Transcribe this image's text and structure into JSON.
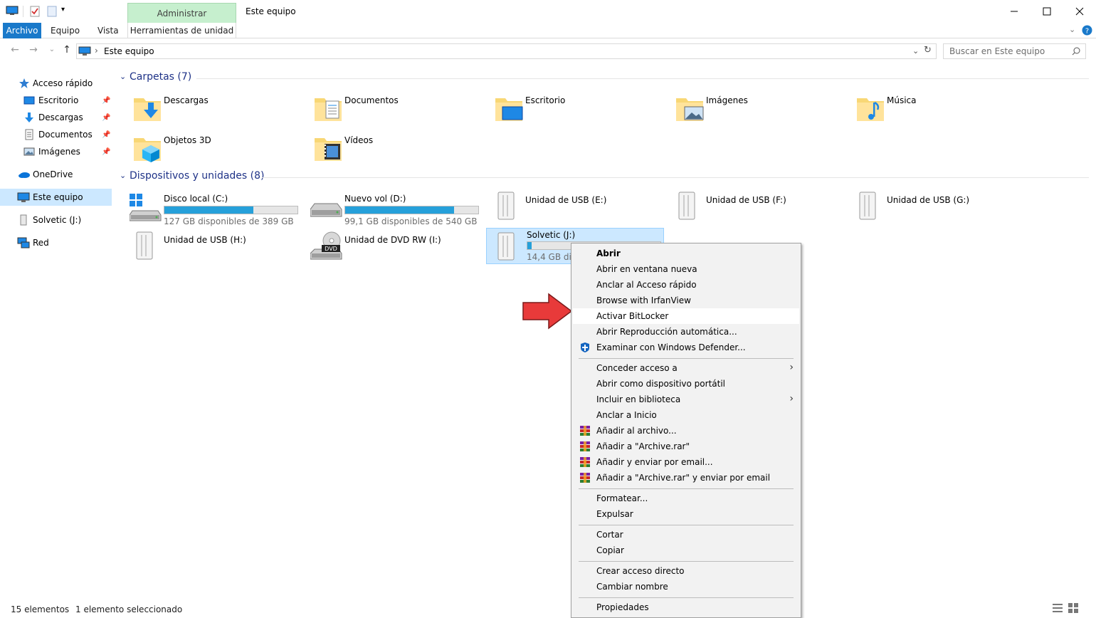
{
  "window": {
    "title": "Este equipo"
  },
  "ribbon": {
    "context_tab": "Administrar",
    "context_subtitle": "Herramientas de unidad",
    "tabs": [
      "Archivo",
      "Equipo",
      "Vista"
    ]
  },
  "address": {
    "path": "Este equipo",
    "search_placeholder": "Buscar en Este equipo"
  },
  "sidebar": {
    "items": [
      {
        "label": "Acceso rápido",
        "icon": "star-icon"
      },
      {
        "label": "Escritorio",
        "icon": "desktop-icon",
        "pinned": true
      },
      {
        "label": "Descargas",
        "icon": "download-icon",
        "pinned": true
      },
      {
        "label": "Documentos",
        "icon": "document-icon",
        "pinned": true
      },
      {
        "label": "Imágenes",
        "icon": "pictures-icon",
        "pinned": true
      },
      {
        "label": "OneDrive",
        "icon": "cloud-icon"
      },
      {
        "label": "Este equipo",
        "icon": "computer-icon",
        "selected": true
      },
      {
        "label": "Solvetic (J:)",
        "icon": "usb-drive-icon"
      },
      {
        "label": "Red",
        "icon": "network-icon"
      }
    ]
  },
  "folders": {
    "header": "Carpetas (7)",
    "items": [
      "Descargas",
      "Documentos",
      "Escritorio",
      "Imágenes",
      "Música",
      "Objetos 3D",
      "Vídeos"
    ]
  },
  "devices": {
    "header": "Dispositivos y unidades (8)",
    "items": [
      {
        "name": "Disco local (C:)",
        "free": "127 GB disponibles de 389 GB",
        "used_fraction": 0.67
      },
      {
        "name": "Nuevo vol (D:)",
        "free": "99,1 GB disponibles de 540 GB",
        "used_fraction": 0.82
      },
      {
        "name": "Unidad de USB (E:)"
      },
      {
        "name": "Unidad de USB (F:)"
      },
      {
        "name": "Unidad de USB (G:)"
      },
      {
        "name": "Unidad de USB (H:)"
      },
      {
        "name": "Unidad de DVD RW (I:)",
        "dvd_label": "DVD"
      },
      {
        "name": "Solvetic (J:)",
        "free": "14,4 GB disp",
        "used_fraction": 0.03,
        "selected": true
      }
    ]
  },
  "context_menu": {
    "items": [
      "Abrir",
      "Abrir en ventana nueva",
      "Anclar al Acceso rápido",
      "Browse with IrfanView",
      "Activar BitLocker",
      "Abrir Reproducción automática...",
      "Examinar con Windows Defender...",
      "Conceder acceso a",
      "Abrir como dispositivo portátil",
      "Incluir en biblioteca",
      "Anclar a Inicio",
      "Añadir al archivo...",
      "Añadir a \"Archive.rar\"",
      "Añadir y enviar por email...",
      "Añadir a \"Archive.rar\" y enviar por email",
      "Formatear...",
      "Expulsar",
      "Cortar",
      "Copiar",
      "Crear acceso directo",
      "Cambiar nombre",
      "Propiedades"
    ],
    "highlighted": "Activar BitLocker"
  },
  "status": {
    "count": "15 elementos",
    "selection": "1 elemento seleccionado"
  },
  "colors": {
    "accent": "#1979ca",
    "drive_bar": "#26a0da",
    "selection": "#cce8ff",
    "pointer_arrow": "#e83a3a"
  }
}
